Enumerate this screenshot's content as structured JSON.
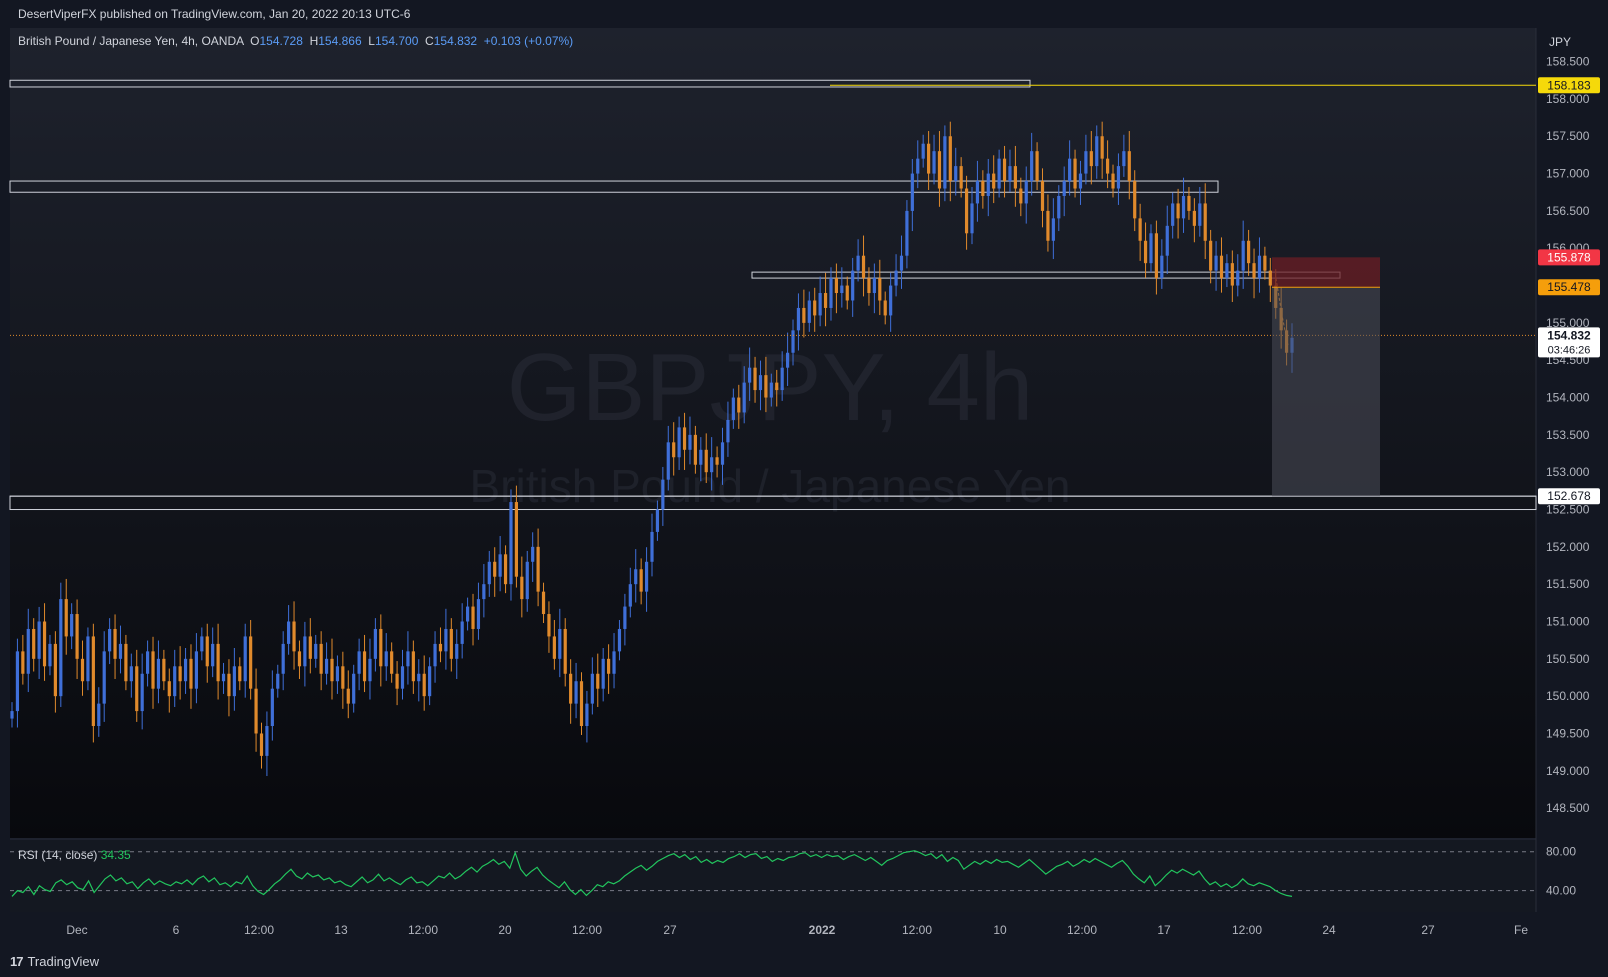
{
  "header": {
    "published_line": "DesertViperFX published on TradingView.com, Jan 20, 2022 20:13 UTC-6"
  },
  "legend": {
    "symbol": "British Pound / Japanese Yen, 4h, OANDA",
    "o_label": "O",
    "o_value": "154.728",
    "h_label": "H",
    "h_value": "154.866",
    "l_label": "L",
    "l_value": "154.700",
    "c_label": "C",
    "c_value": "154.832",
    "change": "+0.103 (+0.07%)"
  },
  "watermark": {
    "ticker": "GBPJPY, 4h",
    "name": "British Pound / Japanese Yen"
  },
  "rsi": {
    "label": "RSI (14, close)",
    "value": "34.35",
    "levels": [
      "80.00",
      "40.00"
    ]
  },
  "footer": {
    "brand": "TradingView",
    "brand_icon": "tradingview-logo-icon"
  },
  "colors": {
    "bull": "#3f6fd8",
    "bear": "#e08a2c",
    "background": "#131722",
    "rsi_line": "#22c55e",
    "current_price": "#e08a2c",
    "stop_zone": "#6b1d24",
    "target_zone": "#4a4d57"
  },
  "chart_data": {
    "type": "candlestick",
    "currency": "JPY",
    "y_ticks": [
      "148.500",
      "149.000",
      "149.500",
      "150.000",
      "150.500",
      "151.000",
      "151.500",
      "152.000",
      "152.500",
      "153.000",
      "153.500",
      "154.000",
      "154.500",
      "155.000",
      "155.500",
      "156.000",
      "156.500",
      "157.000",
      "157.500",
      "158.000",
      "158.500"
    ],
    "x_ticks": [
      "Dec",
      "6",
      "12:00",
      "13",
      "12:00",
      "20",
      "12:00",
      "27",
      "2022",
      "12:00",
      "10",
      "12:00",
      "17",
      "12:00",
      "24",
      "27",
      "Fe"
    ],
    "ylim": [
      148.1,
      158.95
    ],
    "price_labels": [
      {
        "value": "158.183",
        "color": "#f5d90a"
      },
      {
        "value": "155.878",
        "color": "#f23645"
      },
      {
        "value": "155.478",
        "color": "#f59e0b"
      },
      {
        "value": "154.832",
        "color": "#ffffff"
      },
      {
        "value": "152.678",
        "color": "#ffffff"
      }
    ],
    "countdown": "03:46:26",
    "key_levels": [
      158.183,
      152.678
    ],
    "zones": [
      {
        "from": 158.25,
        "to": 158.16
      },
      {
        "from": 156.9,
        "to": 156.75
      },
      {
        "from": 155.68,
        "to": 155.6
      },
      {
        "from": 152.68,
        "to": 152.5
      }
    ],
    "trade_position": {
      "entry": 155.478,
      "stop": 155.878,
      "target": 152.678
    },
    "close_path": [
      149.8,
      150.6,
      150.3,
      150.9,
      150.5,
      151.0,
      150.4,
      150.7,
      150.0,
      151.3,
      150.8,
      151.1,
      150.5,
      150.2,
      150.8,
      149.6,
      149.9,
      150.6,
      150.9,
      150.5,
      150.7,
      150.2,
      150.4,
      149.8,
      150.3,
      150.6,
      150.1,
      150.5,
      150.2,
      150.0,
      150.4,
      150.2,
      150.5,
      150.1,
      150.6,
      150.8,
      150.4,
      150.7,
      150.2,
      150.3,
      150.0,
      150.4,
      150.2,
      150.8,
      150.1,
      149.5,
      149.2,
      149.6,
      150.1,
      150.3,
      150.7,
      151.0,
      150.6,
      150.4,
      150.8,
      150.5,
      150.7,
      150.3,
      150.5,
      150.2,
      150.4,
      150.1,
      149.9,
      150.3,
      150.6,
      150.2,
      150.5,
      150.9,
      150.4,
      150.6,
      150.3,
      150.1,
      150.4,
      150.6,
      150.2,
      150.3,
      150.0,
      150.4,
      150.7,
      150.6,
      150.9,
      150.5,
      150.7,
      151.0,
      151.2,
      150.9,
      151.3,
      151.5,
      151.8,
      151.6,
      151.9,
      151.5,
      152.6,
      151.6,
      151.3,
      151.8,
      152.0,
      151.4,
      151.1,
      150.8,
      150.5,
      150.9,
      150.3,
      149.9,
      150.2,
      149.6,
      149.9,
      150.3,
      150.1,
      150.5,
      150.3,
      150.6,
      150.9,
      151.2,
      151.5,
      151.7,
      151.4,
      151.8,
      152.2,
      152.5,
      152.9,
      153.4,
      153.2,
      153.6,
      153.3,
      153.5,
      153.1,
      153.3,
      153.0,
      153.2,
      153.1,
      153.4,
      153.7,
      154.0,
      153.8,
      154.2,
      154.4,
      154.1,
      154.3,
      154.0,
      154.2,
      154.1,
      154.4,
      154.6,
      154.9,
      155.2,
      155.0,
      155.3,
      155.1,
      155.4,
      155.2,
      155.6,
      155.4,
      155.5,
      155.3,
      155.7,
      155.9,
      155.6,
      155.4,
      155.6,
      155.3,
      155.1,
      155.5,
      155.7,
      155.9,
      156.5,
      157.0,
      157.2,
      157.4,
      157.0,
      157.3,
      156.8,
      157.5,
      156.9,
      157.1,
      156.8,
      156.2,
      156.6,
      156.9,
      156.7,
      157.0,
      156.8,
      157.2,
      156.9,
      157.1,
      156.8,
      156.6,
      156.9,
      157.3,
      156.9,
      156.5,
      156.1,
      156.4,
      156.7,
      156.9,
      157.2,
      156.8,
      157.0,
      157.3,
      157.1,
      157.5,
      157.2,
      157.0,
      156.8,
      157.1,
      157.3,
      156.9,
      156.4,
      156.1,
      155.8,
      156.2,
      155.6,
      155.9,
      156.3,
      156.6,
      156.4,
      156.7,
      156.5,
      156.3,
      156.6,
      156.1,
      155.7,
      155.9,
      155.6,
      155.8,
      155.5,
      155.7,
      156.1,
      155.8,
      155.6,
      155.9,
      155.7,
      155.5,
      155.2,
      154.9,
      154.6,
      154.8
    ],
    "rsi_series": [
      34,
      40,
      38,
      44,
      36,
      45,
      41,
      39,
      48,
      51,
      46,
      49,
      43,
      41,
      50,
      38,
      45,
      52,
      56,
      50,
      53,
      47,
      49,
      42,
      48,
      52,
      46,
      50,
      47,
      45,
      49,
      47,
      51,
      46,
      52,
      55,
      49,
      53,
      46,
      48,
      44,
      49,
      47,
      55,
      45,
      39,
      36,
      41,
      47,
      51,
      57,
      62,
      55,
      52,
      58,
      54,
      56,
      51,
      53,
      48,
      50,
      46,
      44,
      49,
      54,
      48,
      51,
      57,
      50,
      53,
      49,
      46,
      51,
      54,
      48,
      49,
      45,
      50,
      55,
      53,
      58,
      52,
      55,
      60,
      64,
      59,
      65,
      68,
      72,
      67,
      70,
      63,
      79,
      62,
      55,
      60,
      64,
      56,
      51,
      47,
      43,
      49,
      41,
      36,
      41,
      35,
      40,
      46,
      44,
      49,
      47,
      50,
      55,
      59,
      63,
      66,
      61,
      65,
      70,
      73,
      76,
      78,
      74,
      77,
      72,
      75,
      69,
      72,
      68,
      71,
      69,
      73,
      75,
      78,
      74,
      77,
      78,
      73,
      75,
      70,
      73,
      71,
      74,
      75,
      78,
      79,
      75,
      77,
      74,
      77,
      75,
      76,
      72,
      75,
      77,
      74,
      71,
      74,
      70,
      66,
      71,
      73,
      76,
      79,
      80,
      81,
      79,
      76,
      78,
      73,
      77,
      70,
      74,
      71,
      62,
      66,
      70,
      67,
      71,
      68,
      72,
      69,
      70,
      67,
      64,
      68,
      72,
      67,
      62,
      57,
      61,
      65,
      67,
      70,
      65,
      68,
      72,
      69,
      73,
      70,
      67,
      64,
      68,
      71,
      65,
      57,
      52,
      48,
      55,
      45,
      50,
      56,
      61,
      58,
      62,
      59,
      56,
      60,
      52,
      46,
      49,
      44,
      47,
      43,
      46,
      52,
      47,
      45,
      48,
      46,
      44,
      40,
      37,
      35,
      34
    ]
  }
}
